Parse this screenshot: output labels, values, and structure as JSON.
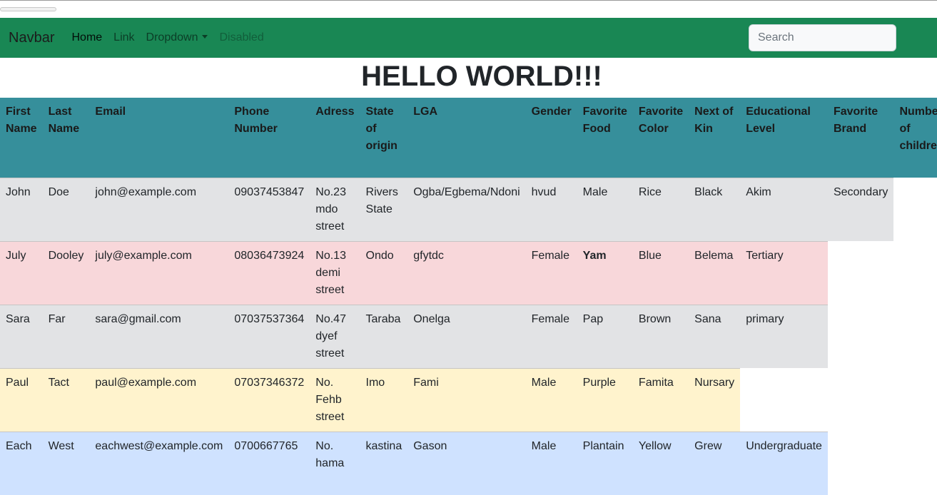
{
  "navbar": {
    "brand": "Navbar",
    "links": [
      {
        "label": "Home"
      },
      {
        "label": "Link"
      },
      {
        "label": "Dropdown"
      },
      {
        "label": "Disabled"
      }
    ],
    "search_placeholder": "Search",
    "background": "#198754"
  },
  "heading": "HELLO WORLD!!!",
  "table": {
    "header_color": "#368f9b",
    "headers": [
      "First Name",
      "Last Name",
      "Email",
      "Phone Number",
      "Adress",
      "State of origin",
      "LGA",
      "Gender",
      "Favorite Food",
      "Favorite Color",
      "Next of Kin",
      "Educational Level",
      "Favorite Brand",
      "Number of children"
    ],
    "rows": [
      {
        "variant": "gray",
        "cells": [
          "John",
          "Doe",
          "john@example.com",
          "09037453847",
          "No.23 mdo street",
          "Rivers State",
          "Ogba/Egbema/Ndoni",
          "hvud",
          "Male",
          "Rice",
          "Black",
          "Akim",
          "Secondary"
        ]
      },
      {
        "variant": "red",
        "cells": [
          "July",
          "Dooley",
          "july@example.com",
          "08036473924",
          "No.13 demi street",
          "Ondo",
          "gfytdc",
          "Female",
          "Yam",
          "Blue",
          "Belema",
          "Tertiary"
        ]
      },
      {
        "variant": "gray",
        "cells": [
          "Sara",
          "Far",
          "sara@gmail.com",
          "07037537364",
          "No.47 dyef street",
          "Taraba",
          "Onelga",
          "Female",
          "Pap",
          "Brown",
          "Sana",
          "primary"
        ]
      },
      {
        "variant": "yellow",
        "cells": [
          "Paul",
          "Tact",
          "paul@example.com",
          "07037346372",
          "No. Fehb street",
          "Imo",
          "Fami",
          "Male",
          "Purple",
          "Famita",
          "Nursary"
        ]
      },
      {
        "variant": "blue",
        "cells": [
          "Each",
          "West",
          "eachwest@example.com",
          "0700667765",
          "No. hama",
          "kastina",
          "Gason",
          "Male",
          "Plantain",
          "Yellow",
          "Grew",
          "Undergraduate"
        ]
      }
    ]
  }
}
